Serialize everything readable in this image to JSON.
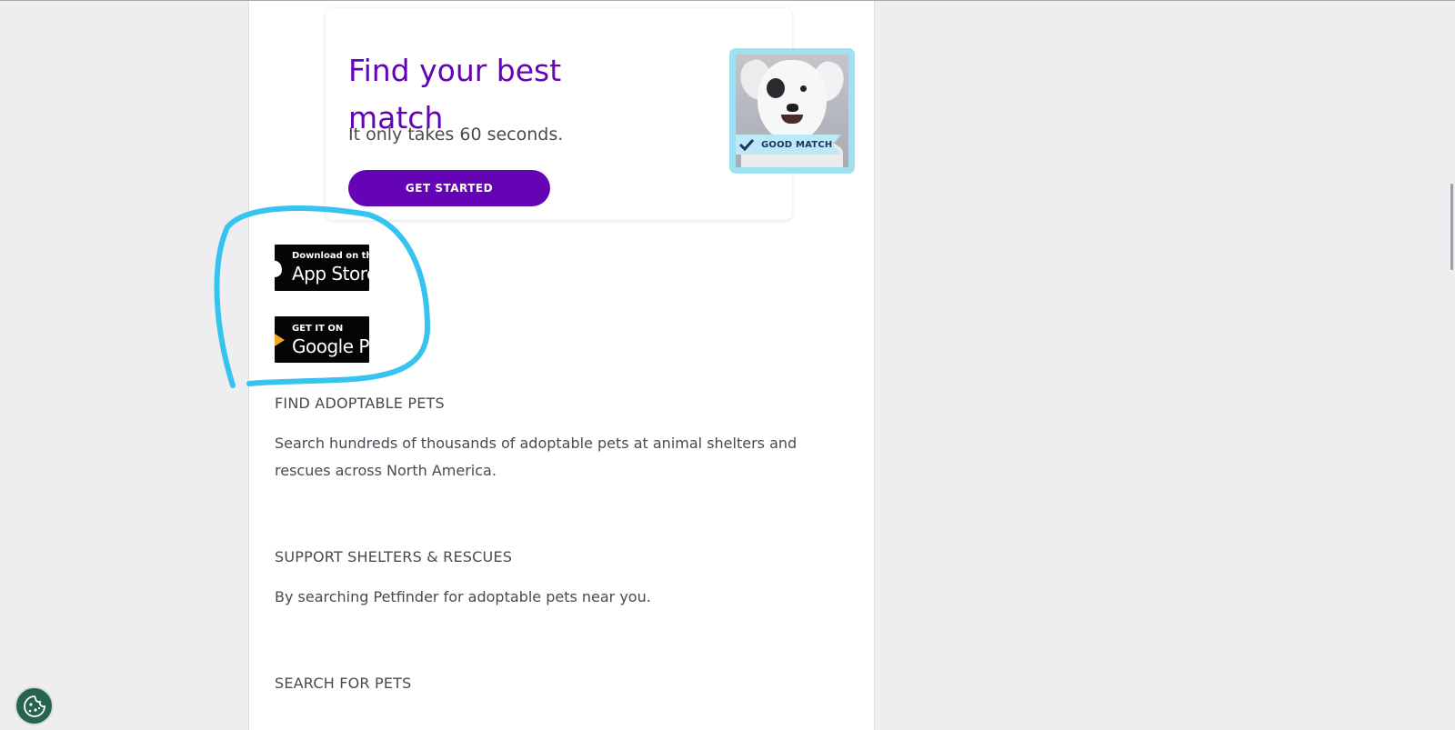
{
  "card": {
    "title": "Find your best match",
    "subtitle": "It only takes 60 seconds.",
    "cta_label": "GET STARTED",
    "badge_label": "GOOD MATCH",
    "photo_icon": "dog-photo"
  },
  "app_links": {
    "apple_small": "Download on the",
    "apple_big": "App Store",
    "google_small": "GET IT ON",
    "google_big": "Google Play"
  },
  "sections": [
    {
      "heading": "FIND ADOPTABLE PETS",
      "text": "Search hundreds of thousands of adoptable pets at animal shelters and rescues across North America."
    },
    {
      "heading": "SUPPORT SHELTERS & RESCUES",
      "text": "By searching Petfinder for adoptable pets near you."
    },
    {
      "heading": "SEARCH FOR PETS"
    }
  ],
  "colors": {
    "brand_purple": "#6504b5",
    "annotation_blue": "#35c3ef",
    "cookie_green": "#27634e"
  },
  "icons": {
    "apple": "apple-icon",
    "google_play": "google-play-icon",
    "check": "check-icon",
    "cookie": "cookie-icon"
  }
}
